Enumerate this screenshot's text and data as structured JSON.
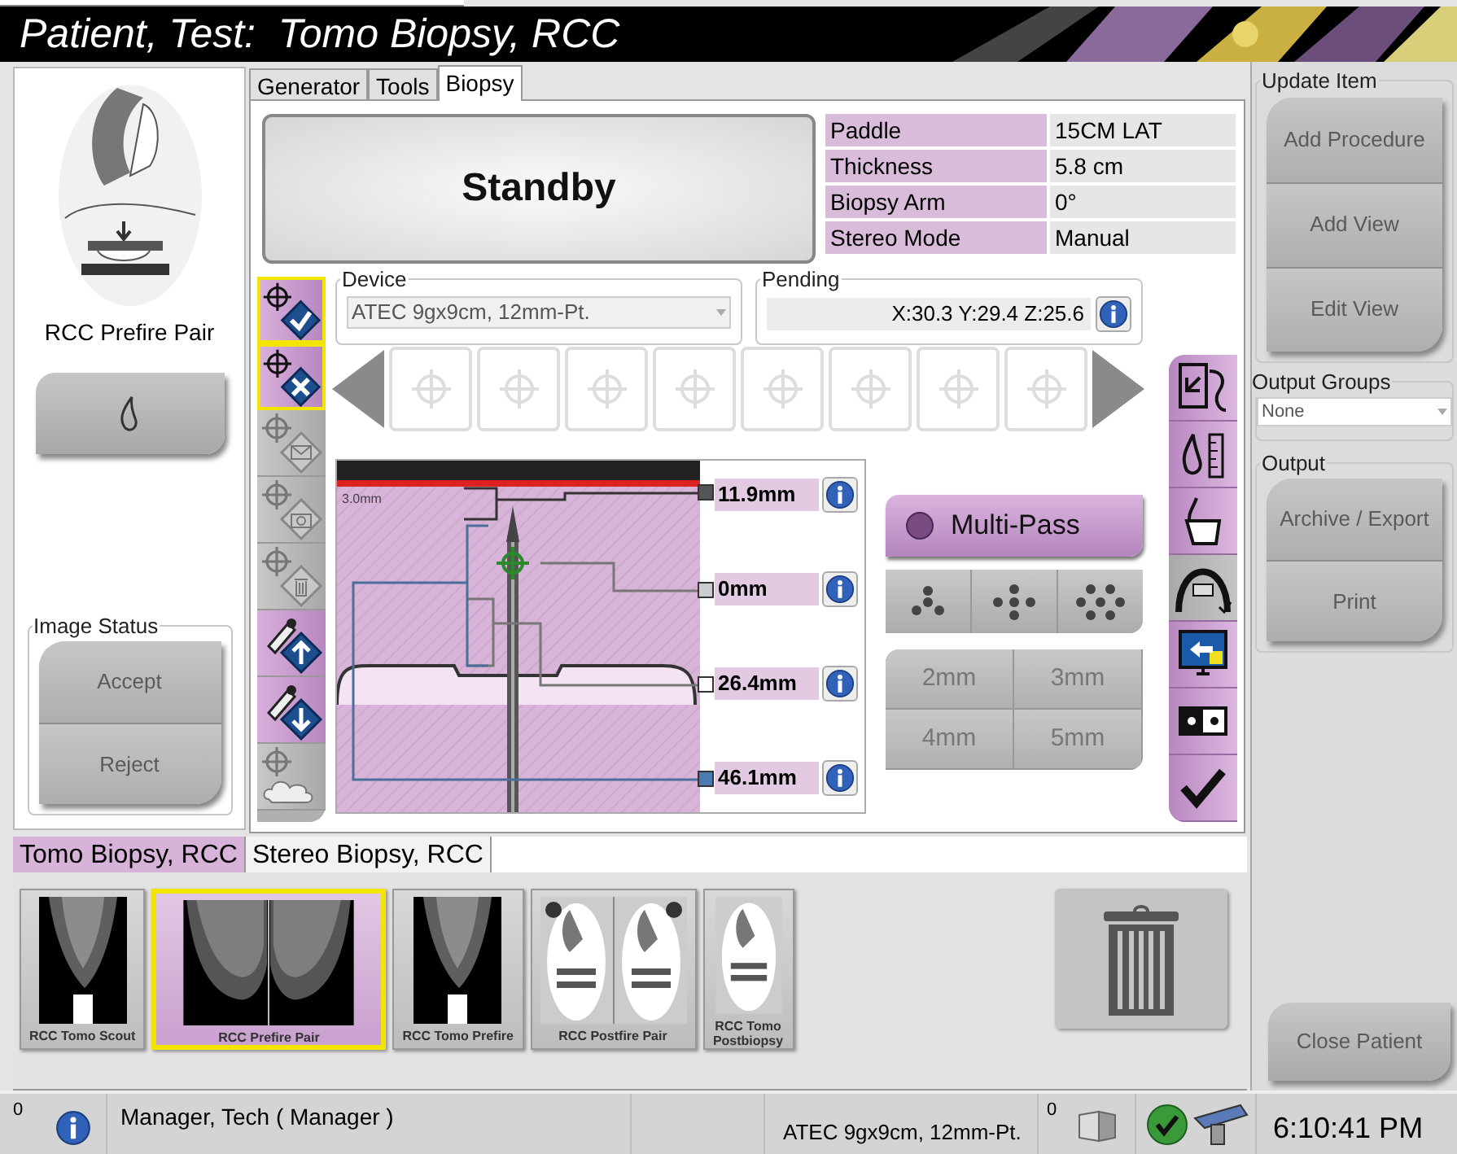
{
  "title": "Patient, Test:  Tomo Biopsy, RCC",
  "view_label": "RCC Prefire Pair",
  "image_status": {
    "title": "Image Status",
    "buttons": [
      "Accept",
      "Reject"
    ]
  },
  "tabs": [
    {
      "label": "Generator",
      "selected": false
    },
    {
      "label": "Tools",
      "selected": false
    },
    {
      "label": "Biopsy",
      "selected": true
    }
  ],
  "status": "Standby",
  "info": [
    {
      "label": "Paddle",
      "value": "15CM LAT"
    },
    {
      "label": "Thickness",
      "value": "5.8 cm"
    },
    {
      "label": "Biopsy Arm",
      "value": "0°"
    },
    {
      "label": "Stereo Mode",
      "value": "Manual"
    }
  ],
  "device": {
    "label": "Device",
    "value": "ATEC 9gx9cm, 12mm-Pt."
  },
  "pending": {
    "label": "Pending",
    "value": "X:30.3 Y:29.4 Z:25.6"
  },
  "left_tools": [
    {
      "kind": "accept",
      "enabled": true,
      "selected": true
    },
    {
      "kind": "reject",
      "enabled": true,
      "selected": true
    },
    {
      "kind": "send",
      "enabled": false,
      "selected": false
    },
    {
      "kind": "capture",
      "enabled": false,
      "selected": false
    },
    {
      "kind": "delete",
      "enabled": false,
      "selected": false
    },
    {
      "kind": "needle-up",
      "enabled": true,
      "selected": false
    },
    {
      "kind": "needle-down",
      "enabled": true,
      "selected": false
    },
    {
      "kind": "cloud",
      "enabled": false,
      "selected": false
    }
  ],
  "diagram": {
    "scale": "3.0mm",
    "measurements": [
      "11.9mm",
      "0mm",
      "26.4mm",
      "46.1mm"
    ]
  },
  "multi_pass": "Multi-Pass",
  "patterns": [
    {
      "kind": "three"
    },
    {
      "kind": "five"
    },
    {
      "kind": "seven"
    }
  ],
  "spacings": [
    "2mm",
    "3mm",
    "4mm",
    "5mm"
  ],
  "right_tools": [
    {
      "kind": "swap",
      "selected": false
    },
    {
      "kind": "ruler",
      "selected": false
    },
    {
      "kind": "hand",
      "selected": false
    },
    {
      "kind": "arc",
      "selected": true
    },
    {
      "kind": "monitor",
      "selected": false
    },
    {
      "kind": "dots",
      "selected": false
    },
    {
      "kind": "check",
      "selected": false
    }
  ],
  "procedure_tabs": [
    {
      "label": "Tomo Biopsy, RCC",
      "selected": true
    },
    {
      "label": "Stereo Biopsy, RCC",
      "selected": false
    }
  ],
  "thumbnails": [
    {
      "kind": "scout",
      "label": "RCC Tomo Scout",
      "selected": false
    },
    {
      "kind": "pair",
      "label": "RCC Prefire Pair",
      "selected": true
    },
    {
      "kind": "scout",
      "label": "RCC Tomo Prefire",
      "selected": false
    },
    {
      "kind": "postfire",
      "label": "RCC Postfire Pair",
      "selected": false
    },
    {
      "kind": "illustration",
      "label": "RCC Tomo Postbiopsy",
      "selected": false
    }
  ],
  "update_item": {
    "title": "Update Item",
    "buttons": [
      "Add Procedure",
      "Add View",
      "Edit View"
    ]
  },
  "output_groups": {
    "title": "Output Groups",
    "value": "None"
  },
  "output": {
    "title": "Output",
    "buttons": [
      "Archive / Export",
      "Print"
    ]
  },
  "close_patient": "Close Patient",
  "status_bar": {
    "alerts": "0",
    "user": "Manager, Tech ( Manager )",
    "device": "ATEC 9gx9cm, 12mm-Pt.",
    "queue": "0",
    "time": "6:10:41 PM"
  }
}
